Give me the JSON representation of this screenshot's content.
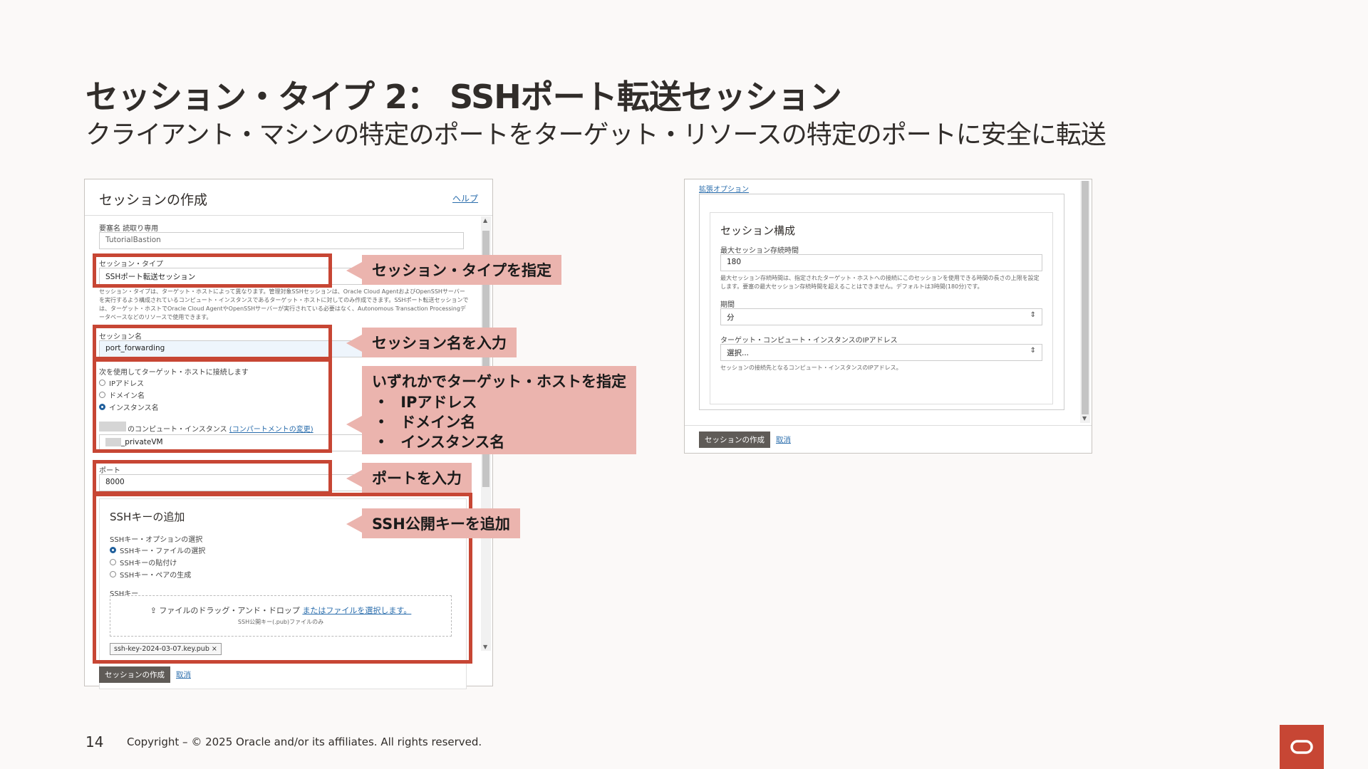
{
  "slide": {
    "title": "セッション・タイプ 2： SSHポート転送セッション",
    "subtitle": "クライアント・マシンの特定のポートをターゲット・リソースの特定のポートに安全に転送",
    "page_number": "14",
    "copyright": "Copyright – © 2025 Oracle and/or its affiliates. All rights reserved."
  },
  "create_session_panel": {
    "title": "セッションの作成",
    "help_link": "ヘルプ",
    "bastion_label": "要塞名 読取り専用",
    "bastion_value": "TutorialBastion",
    "session_type_label": "セッション・タイプ",
    "session_type_value": "SSHポート転送セッション",
    "session_type_help": "セッション・タイプは、ターゲット・ホストによって異なります。管理対象SSHセッションは、Oracle Cloud AgentおよびOpenSSHサーバーを実行するよう構成されているコンピュート・インスタンスであるターゲット・ホストに対してのみ作成できます。SSHポート転送セッションでは、ターゲット・ホストでOracle Cloud AgentやOpenSSHサーバーが実行されている必要はなく、Autonomous Transaction Processingデータベースなどのリソースで使用できます。",
    "session_name_label": "セッション名",
    "session_name_value": "port_forwarding",
    "connect_using_label": "次を使用してターゲット・ホストに接続します",
    "connect_options": [
      "IPアドレス",
      "ドメイン名",
      "インスタンス名"
    ],
    "compute_instance_label": "のコンピュート・インスタンス",
    "change_compartment_link": "(コンパートメントの変更)",
    "compute_instance_value": "_privateVM",
    "port_label": "ポート",
    "port_value": "8000",
    "ssh_section_title": "SSHキーの追加",
    "ssh_option_label": "SSHキー・オプションの選択",
    "ssh_options": [
      "SSHキー・ファイルの選択",
      "SSHキーの貼付け",
      "SSHキー・ペアの生成"
    ],
    "ssh_key_label": "SSHキー",
    "drop_text": "ファイルのドラッグ・アンド・ドロップ",
    "drop_link": "またはファイルを選択します。",
    "drop_subtext": "SSH公開キー(.pub)ファイルのみ",
    "file_name": "ssh-key-2024-03-07.key.pub",
    "file_remove": "×",
    "create_button": "セッションの作成",
    "cancel_link": "取消"
  },
  "callouts": {
    "session_type": "セッション・タイプを指定",
    "session_name": "セッション名を入力",
    "target_host": "いずれかでターゲット・ホストを指定",
    "target_host_items": [
      "IPアドレス",
      "ドメイン名",
      "インスタンス名"
    ],
    "port": "ポートを入力",
    "ssh_key": "SSH公開キーを追加"
  },
  "advanced_panel": {
    "top_link": "拡張オプション",
    "card_title": "セッション構成",
    "max_ttl_label": "最大セッション存続時間",
    "max_ttl_value": "180",
    "max_ttl_help": "最大セッション存続時間は、指定されたターゲット・ホストへの接続にこのセッションを使用できる時間の長さの上限を設定します。要塞の最大セッション存続時間を超えることはできません。デフォルトは3時間(180分)です。",
    "unit_label": "期間",
    "unit_value": "分",
    "target_ip_label": "ターゲット・コンピュート・インスタンスのIPアドレス",
    "target_ip_value": "選択...",
    "target_ip_help": "セッションの接続先となるコンピュート・インスタンスのIPアドレス。",
    "create_button": "セッションの作成",
    "cancel_link": "取消"
  },
  "colors": {
    "accent_red": "#c74634",
    "callout_bg": "#ebb4ae",
    "button_dark": "#5f5b57",
    "link_blue": "#2a6dac"
  },
  "icons": {
    "upload": "upload-icon",
    "select_arrow": "chevron-updown-icon",
    "oracle_logo": "oracle-logo-icon"
  }
}
